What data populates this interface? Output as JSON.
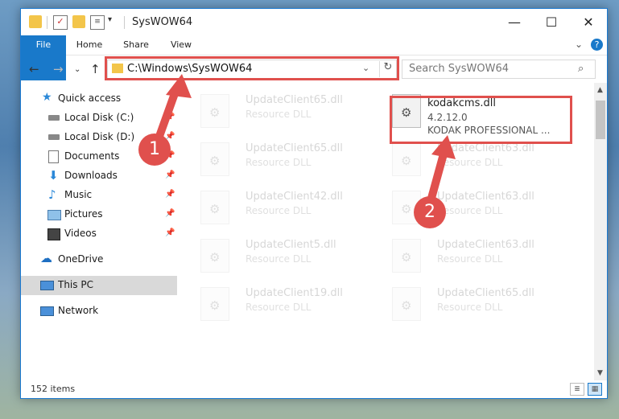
{
  "window": {
    "title": "SysWOW64"
  },
  "window_controls": {
    "minimize": "—",
    "maximize": "☐",
    "close": "✕"
  },
  "ribbon": {
    "tabs": [
      "File",
      "Home",
      "Share",
      "View"
    ]
  },
  "address": {
    "path": "C:\\Windows\\SysWOW64",
    "search_placeholder": "Search SysWOW64"
  },
  "nav": {
    "items": [
      {
        "label": "Quick access",
        "icon": "star-icon",
        "pinned": false
      },
      {
        "label": "Local Disk (C:)",
        "icon": "drive-icon",
        "pinned": true
      },
      {
        "label": "Local Disk (D:)",
        "icon": "drive-icon",
        "pinned": true
      },
      {
        "label": "Documents",
        "icon": "documents-icon",
        "pinned": true
      },
      {
        "label": "Downloads",
        "icon": "download-icon",
        "pinned": true
      },
      {
        "label": "Music",
        "icon": "music-icon",
        "pinned": true
      },
      {
        "label": "Pictures",
        "icon": "pictures-icon",
        "pinned": true
      },
      {
        "label": "Videos",
        "icon": "videos-icon",
        "pinned": true
      },
      {
        "label": "OneDrive",
        "icon": "cloud-icon",
        "pinned": false
      },
      {
        "label": "This PC",
        "icon": "computer-icon",
        "pinned": false,
        "selected": true
      },
      {
        "label": "Network",
        "icon": "network-icon",
        "pinned": false
      }
    ]
  },
  "files": {
    "highlighted": {
      "name": "kodakcms.dll",
      "version": "4.2.12.0",
      "company": "KODAK PROFESSIONAL ..."
    },
    "faded": [
      {
        "name": "UpdateClient65.dll",
        "type": "Resource DLL"
      },
      {
        "name": "UpdateClient65.dll",
        "type": "Resource DLL"
      },
      {
        "name": "UpdateClient63.dll",
        "type": "Resource DLL"
      },
      {
        "name": "UpdateClient42.dll",
        "type": "Resource DLL"
      },
      {
        "name": "UpdateClient63.dll",
        "type": "Resource DLL"
      },
      {
        "name": "UpdateClient5.dll",
        "type": "Resource DLL"
      },
      {
        "name": "UpdateClient63.dll",
        "type": "Resource DLL"
      },
      {
        "name": "UpdateClient19.dll",
        "type": "Resource DLL"
      },
      {
        "name": "UpdateClient65.dll",
        "type": "Resource DLL"
      }
    ]
  },
  "status": {
    "count": "152 items"
  },
  "annotations": {
    "step1": "1",
    "step2": "2"
  },
  "colors": {
    "accent": "#1979ca",
    "highlight": "#e0504d"
  }
}
